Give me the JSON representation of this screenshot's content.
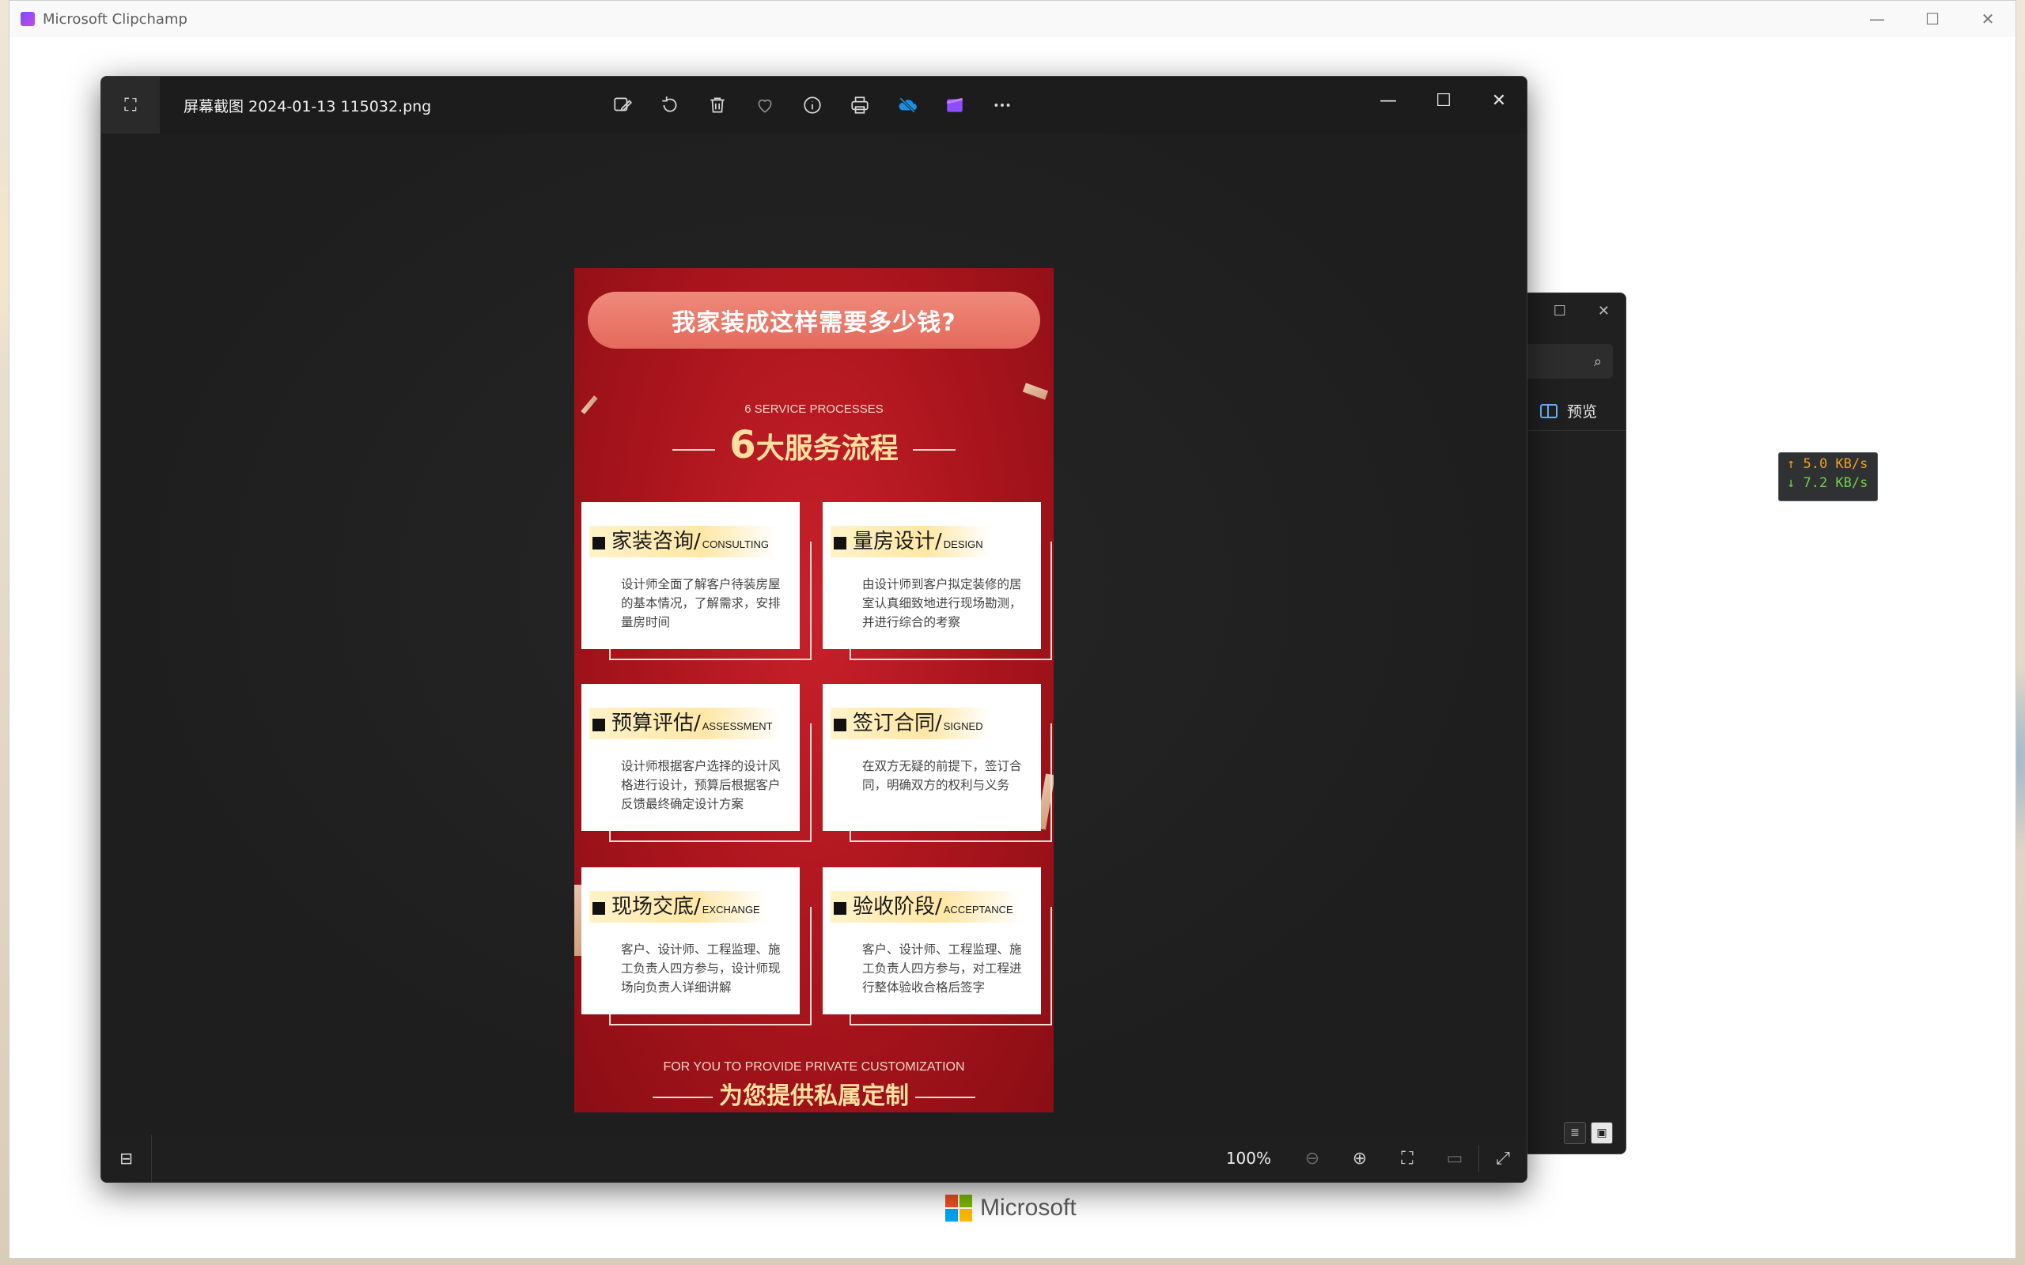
{
  "background_app": {
    "title": "Microsoft Clipchamp",
    "brand": "Microsoft",
    "controls": {
      "minimize": "—",
      "maximize": "☐",
      "close": "✕"
    }
  },
  "side_window": {
    "preview_label": "预览"
  },
  "netspeed": {
    "upload": "↑ 5.0 KB/s",
    "download": "↓ 7.2 KB/s"
  },
  "photos": {
    "filename": "屏幕截图 2024-01-13 115032.png",
    "toolbar": [
      {
        "name": "edit-image-icon",
        "glyph": "✎"
      },
      {
        "name": "rotate-icon",
        "glyph": "⟳"
      },
      {
        "name": "delete-icon",
        "glyph": "🗑"
      },
      {
        "name": "favorite-icon",
        "glyph": "♡"
      },
      {
        "name": "info-icon",
        "glyph": "ⓘ"
      },
      {
        "name": "print-icon",
        "glyph": "⎙"
      },
      {
        "name": "onedrive-icon",
        "glyph": "☁"
      },
      {
        "name": "clipchamp-icon",
        "glyph": "▰"
      },
      {
        "name": "more-icon",
        "glyph": "⋯"
      }
    ],
    "window_controls": {
      "minimize": "—",
      "maximize": "☐",
      "close": "✕"
    },
    "zoom": "100%"
  },
  "poster": {
    "banner": "我家装成这样需要多少钱?",
    "subtitle_en": "6 SERVICE PROCESSES",
    "heading_num": "6",
    "heading_text": "大服务流程",
    "cards": [
      {
        "cn": "家装咨询/",
        "en": "CONSULTING",
        "desc": "设计师全面了解客户待装房屋的基本情况，了解需求，安排量房时间"
      },
      {
        "cn": "量房设计/",
        "en": "DESIGN",
        "desc": "由设计师到客户拟定装修的居室认真细致地进行现场勘测，并进行综合的考察"
      },
      {
        "cn": "预算评估/",
        "en": "ASSESSMENT",
        "desc": "设计师根据客户选择的设计风格进行设计，预算后根据客户反馈最终确定设计方案"
      },
      {
        "cn": "签订合同/",
        "en": "SIGNED",
        "desc": "在双方无疑的前提下，签订合同，明确双方的权利与义务"
      },
      {
        "cn": "现场交底/",
        "en": "EXCHANGE",
        "desc": "客户、设计师、工程监理、施工负责人四方参与，设计师现场向负责人详细讲解"
      },
      {
        "cn": "验收阶段/",
        "en": "ACCEPTANCE",
        "desc": "客户、设计师、工程监理、施工负责人四方参与，对工程进行整体验收合格后签字"
      }
    ],
    "footer_en": "FOR YOU TO PROVIDE PRIVATE CUSTOMIZATION",
    "footer_cn": "为您提供私属定制"
  }
}
